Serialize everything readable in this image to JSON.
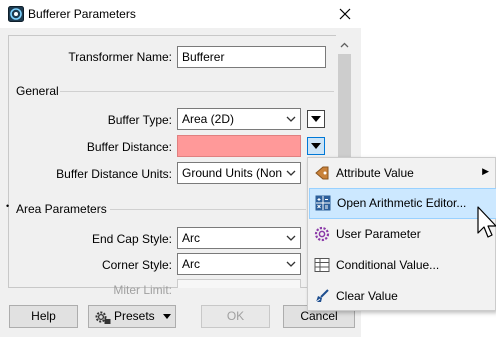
{
  "window": {
    "title": "Bufferer Parameters"
  },
  "form": {
    "transformer_name_label": "Transformer Name:",
    "transformer_name_value": "Bufferer",
    "general_section": "General",
    "buffer_type_label": "Buffer Type:",
    "buffer_type_value": "Area (2D)",
    "buffer_distance_label": "Buffer Distance:",
    "buffer_distance_value": "",
    "buffer_distance_units_label": "Buffer Distance Units:",
    "buffer_distance_units_value": "Ground Units (Non",
    "area_section": "Area Parameters",
    "area_section_marker": "•",
    "end_cap_label": "End Cap Style:",
    "end_cap_value": "Arc",
    "corner_label": "Corner Style:",
    "corner_value": "Arc",
    "miter_label": "Miter Limit:"
  },
  "buttons": {
    "help": "Help",
    "presets": "Presets",
    "ok": "OK",
    "cancel": "Cancel"
  },
  "menu": {
    "items": [
      {
        "label": "Attribute Value",
        "icon": "attribute-value-icon",
        "submenu": true
      },
      {
        "label": "Open Arithmetic Editor...",
        "icon": "arithmetic-editor-icon",
        "highlighted": true
      },
      {
        "label": "User Parameter",
        "icon": "user-parameter-icon"
      },
      {
        "label": "Conditional Value...",
        "icon": "conditional-value-icon"
      },
      {
        "label": "Clear Value",
        "icon": "clear-value-icon"
      }
    ],
    "submenu_arrow": "▶"
  },
  "colors": {
    "accent": "#0078d7",
    "error_field": "#ff9999",
    "menu_highlight": "#cce8ff"
  }
}
